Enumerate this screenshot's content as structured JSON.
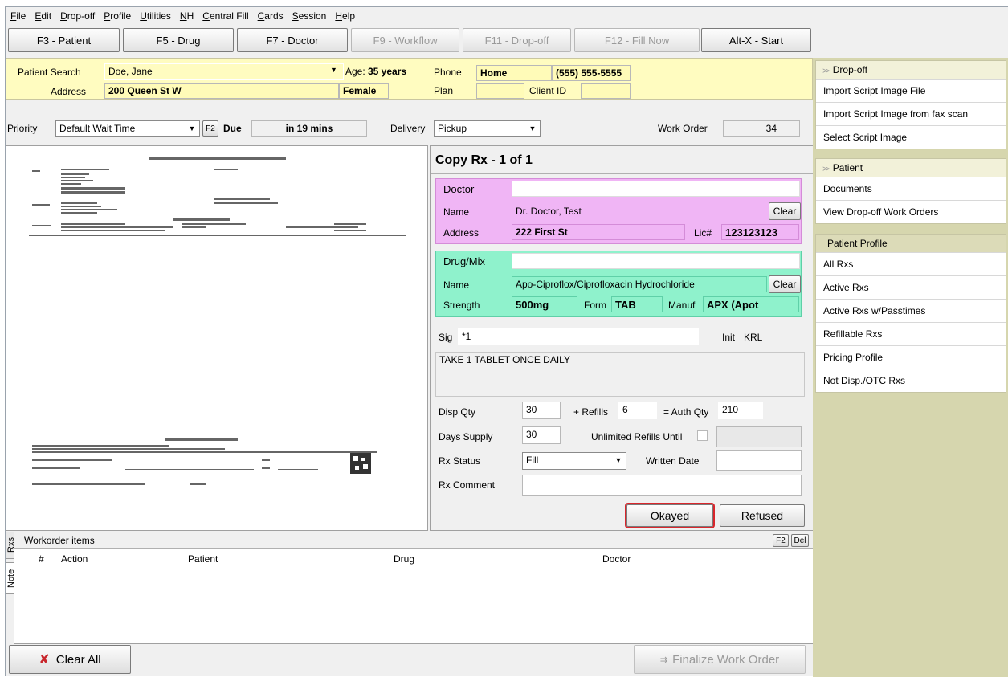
{
  "menu": [
    "File",
    "Edit",
    "Drop-off",
    "Profile",
    "Utilities",
    "NH",
    "Central Fill",
    "Cards",
    "Session",
    "Help"
  ],
  "toolbar": {
    "patient": "F3 - Patient",
    "drug": "F5 - Drug",
    "doctor": "F7 - Doctor",
    "workflow": "F9 - Workflow",
    "dropoff": "F11 - Drop-off",
    "fillnow": "F12 - Fill Now",
    "start": "Alt-X - Start"
  },
  "patient": {
    "search_label": "Patient Search",
    "name": "Doe, Jane",
    "age_label": "Age:",
    "age": "35 years",
    "phone_label": "Phone",
    "phone_type": "Home",
    "phone": "(555) 555-5555",
    "address_label": "Address",
    "address": "200 Queen St W",
    "gender": "Female",
    "plan_label": "Plan",
    "client_id_label": "Client ID"
  },
  "priority": {
    "label": "Priority",
    "value": "Default Wait Time",
    "f2": "F2",
    "due_label": "Due",
    "due": "in 19 mins",
    "delivery_label": "Delivery",
    "delivery": "Pickup",
    "work_order_label": "Work Order",
    "work_order": "34"
  },
  "rx": {
    "title": "Copy Rx - 1 of 1",
    "doctor_section": "Doctor",
    "doctor_name_label": "Name",
    "doctor_name": "Dr. Doctor, Test",
    "clear": "Clear",
    "doctor_address_label": "Address",
    "doctor_address": "222 First St",
    "lic_label": "Lic#",
    "lic": "123123123",
    "drug_section": "Drug/Mix",
    "drug_name_label": "Name",
    "drug_name": "Apo-Ciproflox/Ciprofloxacin Hydrochloride",
    "strength_label": "Strength",
    "strength": "500mg",
    "form_label": "Form",
    "form": "TAB",
    "manuf_label": "Manuf",
    "manuf": "APX (Apot",
    "sig_label": "Sig",
    "sig": "*1",
    "init_label": "Init",
    "init": "KRL",
    "sig_text": "TAKE 1 TABLET ONCE DAILY",
    "disp_qty_label": "Disp Qty",
    "disp_qty": "30",
    "refills_label": "+ Refills",
    "refills": "6",
    "auth_qty_label": "= Auth Qty",
    "auth_qty": "210",
    "days_supply_label": "Days Supply",
    "days_supply": "30",
    "unlimited_label": "Unlimited Refills Until",
    "status_label": "Rx Status",
    "status": "Fill",
    "written_label": "Written Date",
    "comment_label": "Rx Comment",
    "okayed": "Okayed",
    "refused": "Refused"
  },
  "workorder": {
    "title": "Workorder items",
    "f2": "F2",
    "del": "Del",
    "tab_rxs": "Rxs",
    "tab_note": "Note",
    "columns": [
      "#",
      "Action",
      "Patient",
      "Drug",
      "Doctor"
    ]
  },
  "bottom": {
    "clear_all": "Clear All",
    "finalize": "Finalize Work Order"
  },
  "right_panel": {
    "dropoff_title": "Drop-off",
    "dropoff_items": [
      "Import Script Image File",
      "Import Script Image from fax scan",
      "Select Script Image"
    ],
    "patient_title": "Patient",
    "patient_items": [
      "Documents",
      "View Drop-off Work Orders"
    ],
    "profile_title": "Patient Profile",
    "profile_items": [
      "All Rxs",
      "Active Rxs",
      "Active Rxs w/Passtimes",
      "Refillable Rxs",
      "Pricing Profile",
      "Not Disp./OTC Rxs"
    ]
  },
  "colors": {
    "patient_bg": "#fffcc0",
    "doctor_bg": "#f0b5f5",
    "drug_bg": "#8ff2cc",
    "highlight": "#d9262c",
    "right_panel_bg": "#d6d6ae"
  }
}
